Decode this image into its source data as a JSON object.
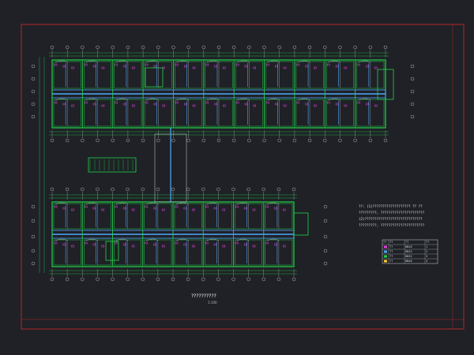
{
  "drawing": {
    "title": "??????????",
    "scale": "1:100",
    "notes": [
      "??: (1)??????????????????? ?? ??",
      "    ?????????, ??????????????????????",
      "(2)?????????????????????????????",
      "    ?????????, ??????????????????????"
    ],
    "legend": {
      "header": [
        "??",
        "??",
        "??",
        "??"
      ],
      "rows": [
        [
          "",
          "??",
          "DN20",
          "1"
        ],
        [
          "",
          "??",
          "DN25",
          "2"
        ],
        [
          "",
          "??",
          "DN32",
          "3"
        ],
        [
          "",
          "??",
          "DN40",
          "4"
        ]
      ]
    }
  },
  "colors": {
    "background": "#1f2126",
    "frame": "#b3272a",
    "wall": "#20d24a",
    "pipe": "#4fa8ff",
    "fixture": "#e040e0",
    "dim": "#cfd3d6",
    "text": "#ffffff"
  }
}
